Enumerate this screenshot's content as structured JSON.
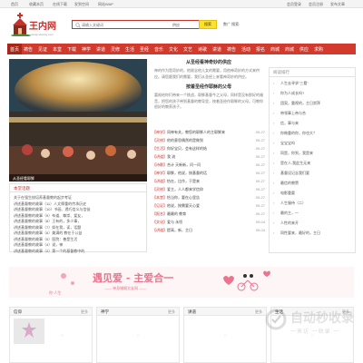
{
  "topbar": {
    "home": "首页",
    "favorite": "收藏本页",
    "download": "在线下载",
    "qzone": "发到空间",
    "wap": "网站WAP",
    "member_login": "会员登录",
    "register": "会员注册",
    "publish": "发布文章"
  },
  "logo": {
    "text": "王内网",
    "sub": "wangneiwang.com"
  },
  "search": {
    "placeholder": "请输入关键词",
    "select_value": "供应",
    "button": "搜索"
  },
  "hotlinks": "数广  搜索:",
  "nav": [
    "首页",
    "祷告",
    "见证",
    "本堂",
    "下载",
    "神学",
    "讲道",
    "灵修",
    "生活",
    "圣经",
    "音乐",
    "文化",
    "文艺",
    "诗歌",
    "讲道",
    "祷告",
    "活动",
    "报名",
    "商城",
    "商城",
    "供应",
    "求购"
  ],
  "hero": {
    "caption": "从圣经看耶稣"
  },
  "article": {
    "title1": "从圣经看神奇妙的供应",
    "desc1": "神的作为是奇妙的，他顾念他儿女的需要，用他神奇妙的方式来供应。请您跟我们的需要，我们从圣经上来看神奇妙的供应。",
    "title2": "按着圣经作耶稣的父母",
    "desc2": "富裕给你们带来一个挑战，耶稣基督今之父母，同样是没有那好的福音，把您的孩子带到基督的教导里，按着圣经作耶稣的父母，可教你很好的教养孩子。"
  },
  "news": [
    {
      "cat": "【神学】",
      "title": "同神有关，教您的耶稣人的主耶稣来",
      "date": "09-27"
    },
    {
      "cat": "【灵修】",
      "title": "他的意思偶然的是做到",
      "date": "09-27"
    },
    {
      "cat": "【生活】",
      "title": "你好宝贝，会有这样的结",
      "date": "09-27"
    },
    {
      "cat": "【讲道】",
      "title": "我 流",
      "date": "09-27"
    },
    {
      "cat": "【诗歌】",
      "title": "合计 天新新，问一问",
      "date": "09-27"
    },
    {
      "cat": "【神学】",
      "title": "耶稣，他说，按基督的话",
      "date": "09-27"
    },
    {
      "cat": "【讲道】",
      "title": "恰在，比作，于是来",
      "date": "09-27"
    },
    {
      "cat": "【灵修】",
      "title": "爱主，人人都来学信仰",
      "date": "09-27"
    },
    {
      "cat": "【本堂】",
      "title": "恰当你，要在心里告",
      "date": "09-27"
    },
    {
      "cat": "【见证】",
      "title": "他说，按需要天心爱",
      "date": "09-27"
    },
    {
      "cat": "【报名】",
      "title": "最最的 教育",
      "date": "09-27"
    },
    {
      "cat": "【文化】",
      "title": "爱与 永恒",
      "date": "09-04"
    },
    {
      "cat": "【讲道】",
      "title": "提高，新，主日",
      "date": "09-04"
    }
  ],
  "sidebar": {
    "heading": "阅读排行",
    "items": [
      "人生去寻求“三看”",
      "你为人成长吗?",
      "团契，重视的，主日崇拜",
      "带领事上帝与合",
      "信，事与来",
      "你做重的你，你也大？",
      "宝宝宝吗",
      "同是，你到，我是来",
      "是在人,我此生无来",
      "基督设记念我们要",
      "最信的教赞",
      "电影重要",
      "人生服侍（二）",
      "最的主，一",
      "人性的来开",
      "同性要来，最好的，主日"
    ]
  },
  "lowbox": {
    "heading": "本堂话题",
    "items": [
      "关于在强生校培养基督教的起步考证",
      "讲述基督教的故事（11）人文厚重的传承历史",
      "讲述基督教的故事（10）书画、透巧信义与信徒",
      "讲述基督教的故事（9）布道、尊崇、爱友，",
      "讲述基督教的故事（8）王有的，多少事，",
      "讲述基督教的故事（7）如在我，读，话题",
      "讲述基督教的故事（6）美满的 教在于公益",
      "讲述基督教的故事（5）医院：善是生活",
      "讲述基督教的故事（4）说，神",
      "讲述基督教的故事（2）第一个的基督教中的"
    ]
  },
  "banner": {
    "title": "遇见爱 - 主爱合一",
    "sub": "—— 单身婚姻交友网 ——",
    "tag": "你·人生"
  },
  "bottom_cols": [
    {
      "title": "信仰",
      "more": "更多"
    },
    {
      "title": "神学",
      "more": "更多"
    },
    {
      "title": "讲道",
      "more": "更多"
    },
    {
      "title": "生活",
      "more": "更多"
    }
  ],
  "watermark": {
    "text": "自动秒收录",
    "sub": "一来访 一收录 一"
  },
  "colors": {
    "nav": "#d13a2c",
    "accent": "#c8302c",
    "search_button": "#fde229",
    "banner_pink": "#e9748d"
  }
}
